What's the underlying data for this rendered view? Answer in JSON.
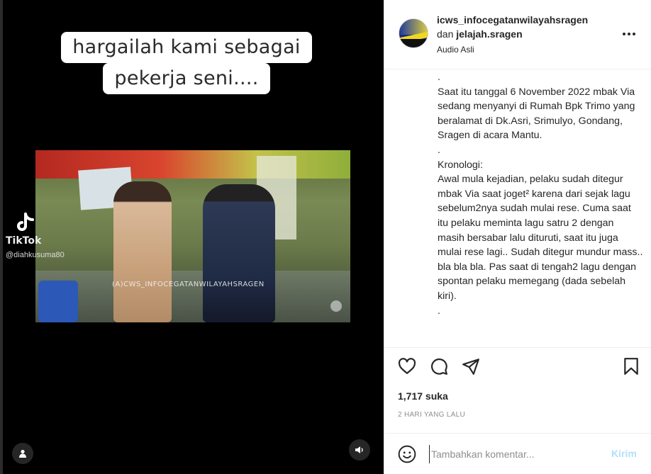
{
  "media": {
    "caption_line_1": "hargailah kami sebagai",
    "caption_line_2": "pekerja seni....",
    "watermark": "(A)CWS_INFOCEGATANWILAYAHSRAGEN",
    "tiktok_brand": "TikTok",
    "tiktok_user": "@diahkusuma80"
  },
  "header": {
    "username": "icws_infocegatanwilayahsragen",
    "and_word": "dan",
    "collaborator": "jelajah.sragen",
    "audio": "Audio Asli"
  },
  "post": {
    "caption": ".\nSaat itu tanggal 6 November 2022 mbak Via sedang menyanyi di Rumah Bpk Trimo yang beralamat di Dk.Asri, Srimulyo, Gondang, Sragen di acara Mantu.\n.\nKronologi:\nAwal mula kejadian, pelaku sudah ditegur mbak Via saat joget² karena dari sejak lagu sebelum2nya sudah mulai rese. Cuma saat itu pelaku meminta lagu satru 2 dengan masih bersabar lalu dituruti, saat itu juga mulai rese lagi.. Sudah ditegur mundur mass.. bla bla bla. Pas saat di tengah2 lagu dengan spontan pelaku memegang (dada sebelah kiri).\n.",
    "likes": "1,717 suka",
    "time": "2 HARI YANG LALU"
  },
  "comment": {
    "placeholder": "Tambahkan komentar...",
    "post_label": "Kirim"
  },
  "icons": [
    "like-icon",
    "comment-icon",
    "share-icon",
    "save-icon",
    "emoji-icon",
    "more-icon",
    "user-tag-icon",
    "sound-icon",
    "tiktok-icon"
  ],
  "colors": {
    "post_disabled": "#b2dffc",
    "muted": "#8e8e8e",
    "text": "#262626"
  }
}
